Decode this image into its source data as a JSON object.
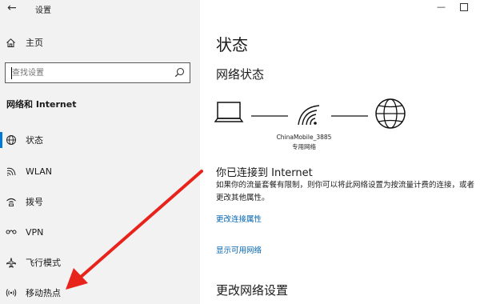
{
  "app": {
    "title": "设置"
  },
  "sidebar": {
    "home_label": "主页",
    "search": {
      "placeholder": "查找设置"
    },
    "section_heading": "网络和 Internet",
    "items": [
      {
        "label": "状态",
        "icon": "globe-status-icon"
      },
      {
        "label": "WLAN",
        "icon": "wifi-icon"
      },
      {
        "label": "拨号",
        "icon": "dialup-icon"
      },
      {
        "label": "VPN",
        "icon": "vpn-icon"
      },
      {
        "label": "飞行模式",
        "icon": "airplane-icon"
      },
      {
        "label": "移动热点",
        "icon": "hotspot-icon"
      }
    ]
  },
  "main": {
    "title": "状态",
    "network_status_heading": "网络状态",
    "network_name": "ChinaMobile_3885",
    "network_type": "专用网络",
    "connected_heading": "你已连接到 Internet",
    "description": "如果你的流量套餐有限制，则你可以将此网络设置为按流量计费的连接，或者更改其他属性。",
    "links": {
      "change_properties": "更改连接属性",
      "show_networks": "显示可用网络"
    },
    "change_settings_heading": "更改网络设置"
  },
  "colors": {
    "accent": "#0078d7",
    "link": "#0063b1",
    "annotation_arrow": "#e8231c"
  }
}
